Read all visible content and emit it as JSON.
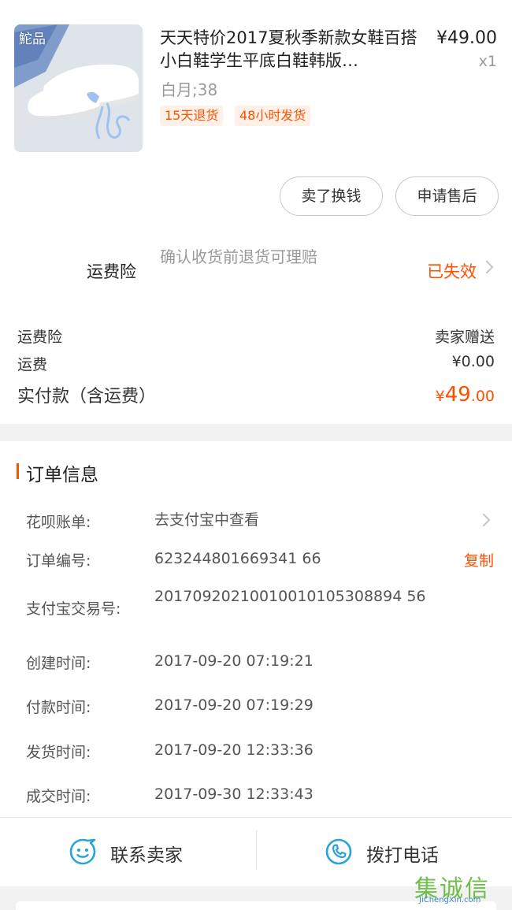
{
  "product": {
    "thumb_tag": "鮀品",
    "title": "天天特价2017夏秋季新款女鞋百搭小白鞋学生平底白鞋韩版…",
    "price": "¥49.00",
    "qty": "x1",
    "spec": "白月;38",
    "tags": [
      "15天退货",
      "48小时发货"
    ]
  },
  "actions": {
    "sell_label": "卖了换钱",
    "after_sale_label": "申请售后"
  },
  "insurance": {
    "label": "运费险",
    "desc": "确认收货前退货可理赔",
    "status": "已失效"
  },
  "summary": {
    "insurance_label": "运费险",
    "insurance_value": "卖家赠送",
    "shipping_label": "运费",
    "shipping_value": "¥0.00",
    "paid_label": "实付款（含运费）",
    "paid_currency": "¥",
    "paid_int": "49",
    "paid_dec": ".00"
  },
  "order_info": {
    "title": "订单信息",
    "huabei_label": "花呗账单:",
    "huabei_value": "去支付宝中查看",
    "order_no_label": "订单编号:",
    "order_no_value": "623244801669341 66",
    "copy_label": "复制",
    "alipay_label": "支付宝交易号:",
    "alipay_value": "20170920210010010105308894 56",
    "created_label": "创建时间:",
    "created_value": "2017-09-20 07:19:21",
    "paid_time_label": "付款时间:",
    "paid_time_value": "2017-09-20 07:19:29",
    "shipped_label": "发货时间:",
    "shipped_value": "2017-09-20 12:33:36",
    "closed_label": "成交时间:",
    "closed_value": "2017-09-30 12:33:43"
  },
  "bottom_bar": {
    "contact_label": "联系卖家",
    "call_label": "拨打电话"
  },
  "watermark": {
    "main": "集诚信",
    "sub": "JiChengXin.com"
  },
  "colors": {
    "accent": "#ff5000",
    "icon_blue": "#2aa3d6",
    "muted": "#9a9a9a"
  }
}
